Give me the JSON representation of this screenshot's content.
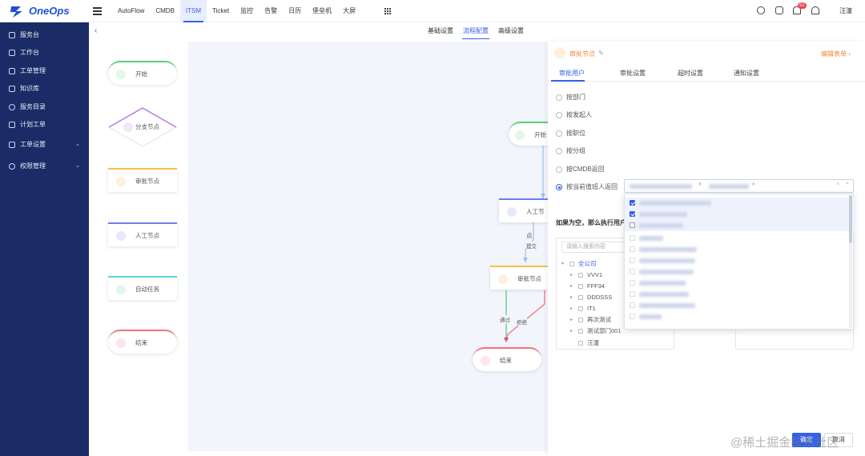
{
  "app": {
    "logo": "OneOps",
    "user": "汪潼",
    "notification_count": "52"
  },
  "nav": [
    "AutoFlow",
    "CMDB",
    "ITSM",
    "Ticket",
    "监控",
    "告警",
    "日历",
    "堡垒机",
    "大屏"
  ],
  "sidebar": [
    {
      "label": "服务台"
    },
    {
      "label": "工作台"
    },
    {
      "label": "工单管理"
    },
    {
      "label": "知识库"
    },
    {
      "label": "服务目录"
    },
    {
      "label": "计划工单"
    },
    {
      "label": "工单设置"
    },
    {
      "label": "权限管理"
    }
  ],
  "subtabs": [
    "基础设置",
    "流程配置",
    "高级设置"
  ],
  "palette": {
    "start": "开始",
    "branch": "分支节点",
    "approve": "审批节点",
    "manual": "人工节点",
    "auto": "自动任务",
    "end": "结束"
  },
  "flow": {
    "start": "开始",
    "manual": "人工节点",
    "approve": "审批节点",
    "end": "结束",
    "submit": "提交",
    "pass": "通过",
    "reject": "拒绝"
  },
  "panel": {
    "title": "审批节点",
    "edit_form": "编辑表单",
    "tabs": [
      "审批用户",
      "审批设置",
      "超时设置",
      "通知设置"
    ],
    "options": [
      "按部门",
      "按发起人",
      "按职位",
      "按分组",
      "按CMDB返回",
      "按当前值班人返回"
    ],
    "empty_hint": "如果为空，那么执行用户为",
    "search_placeholder": "请输入搜索内容",
    "tree": [
      "全公司",
      "VVV1",
      "FFF34",
      "DDDSSS",
      "IT1",
      "再次测试",
      "测试部门001",
      "汪潼"
    ],
    "confirm": "确定",
    "cancel": "取消"
  },
  "watermark": "@稀土掘金技术社区",
  "colors": {
    "primary": "#3461e7",
    "sidebar": "#1a2b66",
    "orange": "#f08a3a",
    "green": "#5bcf7a",
    "purple": "#b47ce8",
    "yellow": "#f5c04a",
    "blue": "#6c7ee8",
    "cyan": "#62d3d6",
    "red": "#f0727f"
  }
}
